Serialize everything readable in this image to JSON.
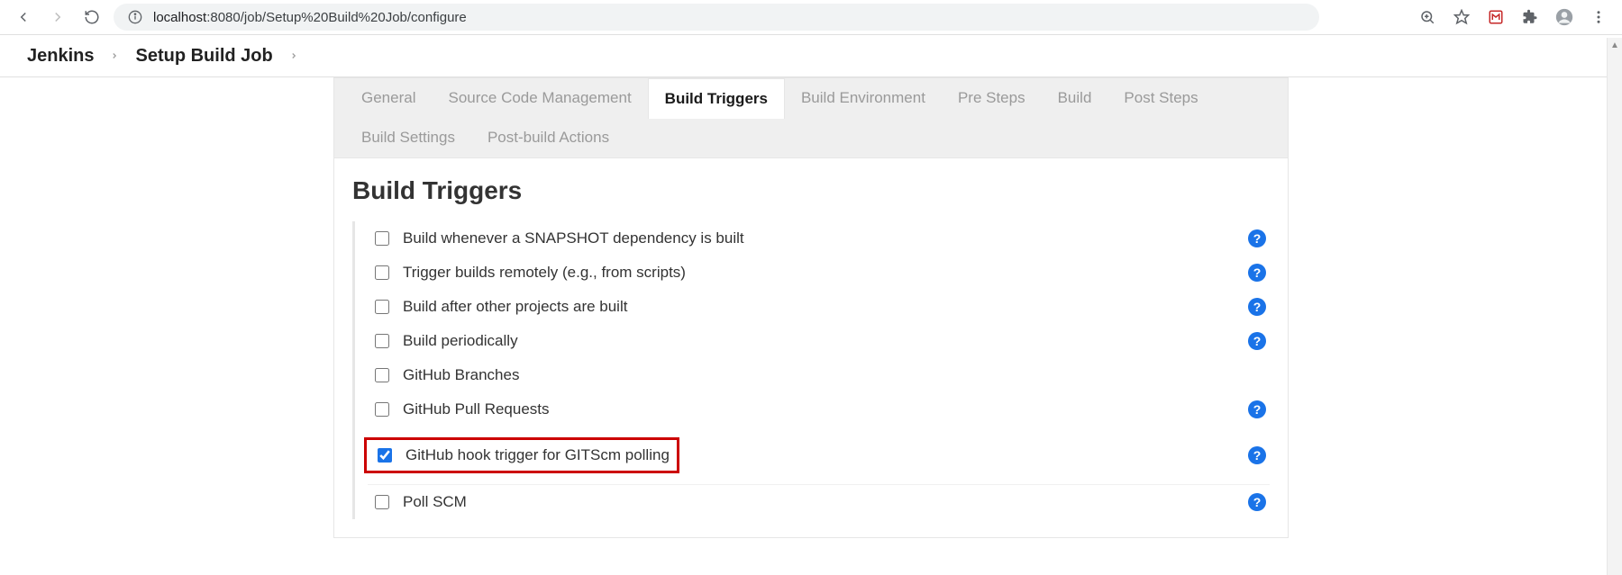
{
  "browser": {
    "url_display_host": "localhost",
    "url_display_rest": ":8080/job/Setup%20Build%20Job/configure"
  },
  "breadcrumbs": {
    "root": "Jenkins",
    "item": "Setup Build Job"
  },
  "tabs": {
    "general": "General",
    "scm": "Source Code Management",
    "triggers": "Build Triggers",
    "env": "Build Environment",
    "pre": "Pre Steps",
    "build": "Build",
    "post": "Post Steps",
    "settings": "Build Settings",
    "postbuild": "Post-build Actions"
  },
  "section_title": "Build Triggers",
  "rows": {
    "snapshot": "Build whenever a SNAPSHOT dependency is built",
    "remote": "Trigger builds remotely (e.g., from scripts)",
    "after": "Build after other projects are built",
    "periodic": "Build periodically",
    "branches": "GitHub Branches",
    "prs": "GitHub Pull Requests",
    "hook": "GitHub hook trigger for GITScm polling",
    "pollscm": "Poll SCM"
  },
  "help_glyph": "?"
}
